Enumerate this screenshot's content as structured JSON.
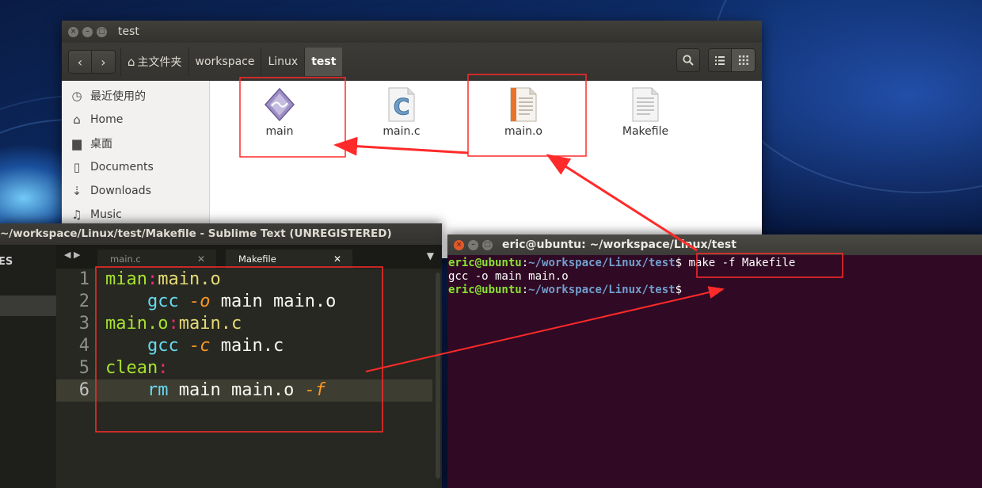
{
  "file_manager": {
    "title": "test",
    "breadcrumbs": [
      "主文件夹",
      "workspace",
      "Linux",
      "test"
    ],
    "sidebar": [
      {
        "label": "最近使用的",
        "icon": "clock-icon"
      },
      {
        "label": "Home",
        "icon": "home-icon"
      },
      {
        "label": "桌面",
        "icon": "folder-icon"
      },
      {
        "label": "Documents",
        "icon": "document-icon"
      },
      {
        "label": "Downloads",
        "icon": "download-icon"
      },
      {
        "label": "Music",
        "icon": "music-icon"
      }
    ],
    "files": [
      {
        "name": "main",
        "icon": "executable-icon"
      },
      {
        "name": "main.c",
        "icon": "c-source-icon"
      },
      {
        "name": "main.o",
        "icon": "object-file-icon"
      },
      {
        "name": "Makefile",
        "icon": "text-file-icon"
      }
    ]
  },
  "sublime": {
    "title": "~/workspace/Linux/test/Makefile - Sublime Text (UNREGISTERED)",
    "sidebar_header": "ES",
    "tabs": [
      "main.c",
      "Makefile"
    ],
    "line_numbers": [
      "1",
      "2",
      "3",
      "4",
      "5",
      "6"
    ],
    "code": {
      "l1_target": "mian",
      "l1_sep": ":",
      "l1_dep": "main.o",
      "l2_cmd": "gcc",
      "l2_flag": "-o",
      "l2_rest": " main main.o",
      "l3_target": "main.o",
      "l3_sep": ":",
      "l3_dep": "main.c",
      "l4_cmd": "gcc",
      "l4_flag": "-c",
      "l4_rest": " main.c",
      "l5_target": "clean",
      "l5_sep": ":",
      "l6_cmd": "rm",
      "l6_rest": " main main.o ",
      "l6_flag": "-f"
    }
  },
  "terminal": {
    "title": "eric@ubuntu: ~/workspace/Linux/test",
    "prompt_user": "eric@ubuntu",
    "prompt_sep": ":",
    "prompt_path": "~/workspace/Linux/test",
    "prompt_dollar": "$",
    "command": " make -f Makefile",
    "output": "gcc -o main main.o"
  },
  "colors": {
    "annotation": "#ff2a2a",
    "terminal_bg": "#300a24",
    "editor_bg": "#272822"
  }
}
